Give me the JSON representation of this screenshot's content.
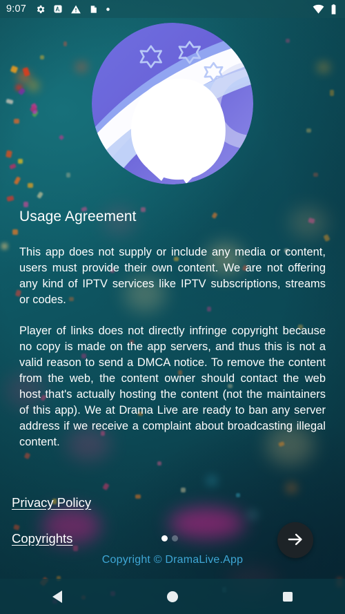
{
  "status_bar": {
    "time": "9:07",
    "left_icons": [
      "gear-icon",
      "a-badge-icon",
      "warning-triangle-icon",
      "sd-card-icon",
      "dot-icon"
    ],
    "right_icons": [
      "wifi-icon",
      "battery-icon"
    ]
  },
  "logo": {
    "name": "drama-live-app-logo",
    "alt": "Drama Live app logo"
  },
  "main": {
    "title": "Usage Agreement",
    "paragraphs": [
      "This app does not supply or include any media or content, users must provide their own content. We are not offering any kind of IPTV services like IPTV subscriptions, streams or codes.",
      "Player of links does not directly infringe copyright because no copy is made on the app servers, and thus this is not a valid reason to send a DMCA notice. To remove the content from the web, the content owner should contact the web host that's actually hosting the content (not the maintainers of this app). We at Drama Live are ready to ban any server address if we receive a complaint about broadcasting illegal content."
    ]
  },
  "links": {
    "privacy_policy": "Privacy Policy",
    "copyrights": "Copyrights"
  },
  "pager": {
    "total": 2,
    "current": 1
  },
  "fab": {
    "icon": "arrow-right-icon",
    "label": "Next"
  },
  "footer": {
    "copyright": "Copyright © DramaLive.App",
    "copyright_color": "#3fa7d6"
  },
  "nav_bar": {
    "back": "back-button",
    "home": "home-button",
    "recents": "recents-button"
  },
  "theme": {
    "background_teal": "#0f5a66",
    "accent_link": "#3fa7d6",
    "fab_background": "#1d2327",
    "text_primary": "#ffffff"
  }
}
